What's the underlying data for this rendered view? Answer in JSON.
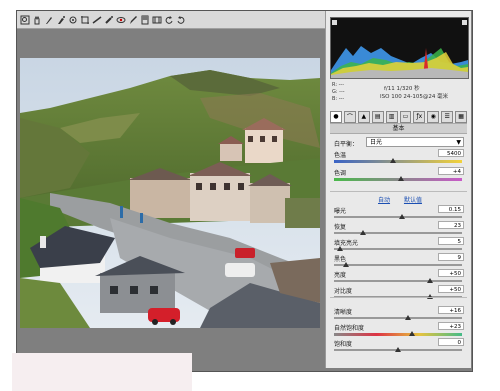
{
  "panel": {
    "section_title": "基本",
    "white_balance": {
      "label": "白平衡：",
      "value": "日光"
    },
    "info": {
      "rgb": [
        "R:  ---",
        "G:  ---",
        "B:  ---"
      ],
      "camera_line1": "f/11   1/320 秒",
      "camera_line2": "ISO 100   24-105@24 毫米"
    },
    "links": {
      "auto": "自动",
      "default": "默认值"
    },
    "sliders": [
      {
        "label": "色温",
        "value": "5400",
        "level": 0.46,
        "track": "temp"
      },
      {
        "label": "色调",
        "value": "+4",
        "level": 0.52,
        "track": "tint"
      },
      {
        "label": "曝光",
        "value": "0.15",
        "level": 0.53,
        "track": "plain"
      },
      {
        "label": "恢复",
        "value": "23",
        "level": 0.23,
        "track": "plain"
      },
      {
        "label": "填充亮光",
        "value": "5",
        "level": 0.05,
        "track": "plain"
      },
      {
        "label": "黑色",
        "value": "9",
        "level": 0.09,
        "track": "plain"
      },
      {
        "label": "亮度",
        "value": "+50",
        "level": 0.75,
        "track": "plain"
      },
      {
        "label": "对比度",
        "value": "+50",
        "level": 0.75,
        "track": "plain"
      },
      {
        "label": "清晰度",
        "value": "+16",
        "level": 0.58,
        "track": "plain"
      },
      {
        "label": "自然饱和度",
        "value": "+23",
        "level": 0.61,
        "track": "vib"
      },
      {
        "label": "饱和度",
        "value": "0",
        "level": 0.5,
        "track": "plain"
      }
    ]
  },
  "icons": [
    "zoom-icon",
    "hand-icon",
    "white-balance-icon",
    "color-sampler-icon",
    "target-adjust-icon",
    "crop-icon",
    "straighten-icon",
    "spot-removal-icon",
    "red-eye-icon",
    "adjust-brush-icon",
    "gradient-icon",
    "prefs-icon",
    "rotate-left-icon",
    "rotate-right-icon"
  ]
}
